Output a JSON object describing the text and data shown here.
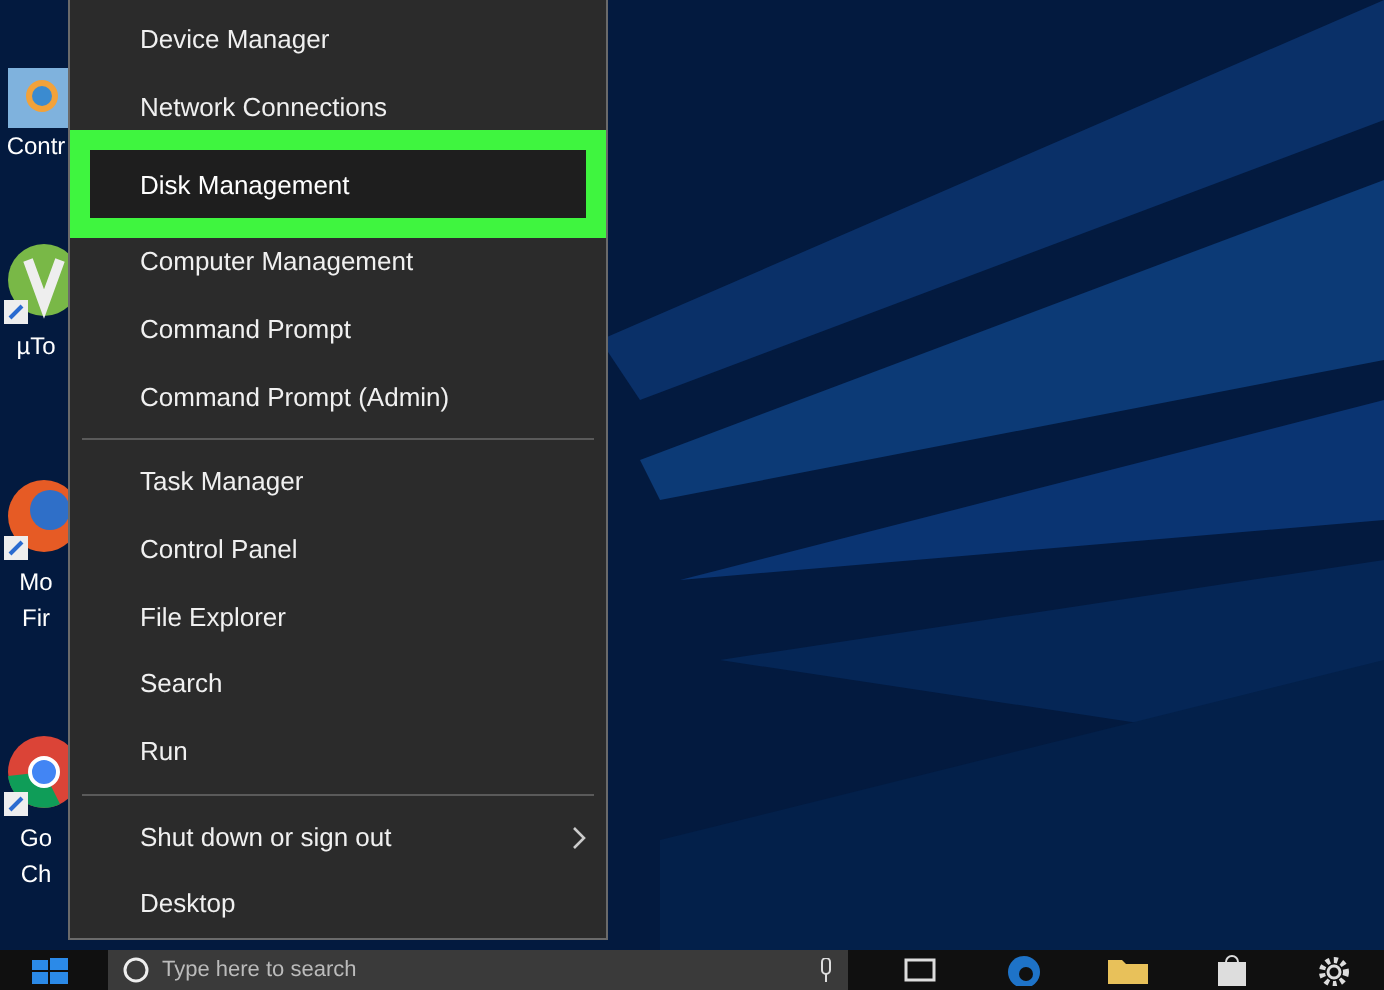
{
  "desktop_icons": [
    {
      "label_lines": [
        "Contr"
      ]
    },
    {
      "label_lines": [
        "µTo"
      ]
    },
    {
      "label_lines": [
        "Mo",
        "Fir"
      ]
    },
    {
      "label_lines": [
        "Go",
        "Ch"
      ]
    }
  ],
  "menu": {
    "groups": [
      [
        {
          "label": "Device Manager",
          "selected": false
        },
        {
          "label": "Network Connections",
          "selected": false
        },
        {
          "label": "Disk Management",
          "selected": true
        },
        {
          "label": "Computer Management",
          "selected": false
        },
        {
          "label": "Command Prompt",
          "selected": false
        },
        {
          "label": "Command Prompt (Admin)",
          "selected": false
        }
      ],
      [
        {
          "label": "Task Manager",
          "selected": false
        },
        {
          "label": "Control Panel",
          "selected": false
        },
        {
          "label": "File Explorer",
          "selected": false
        },
        {
          "label": "Search",
          "selected": false
        },
        {
          "label": "Run",
          "selected": false
        }
      ],
      [
        {
          "label": "Shut down or sign out",
          "selected": false,
          "has_submenu": true
        },
        {
          "label": "Desktop",
          "selected": false
        }
      ]
    ]
  },
  "taskbar": {
    "search": {
      "placeholder": "Type here to search"
    }
  }
}
